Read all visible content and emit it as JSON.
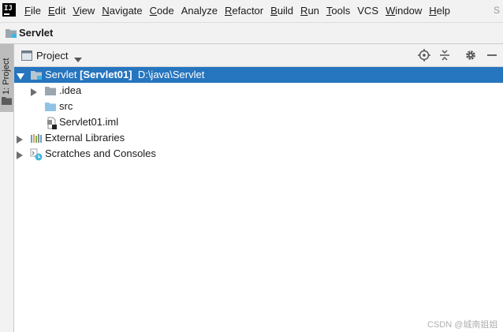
{
  "app": {
    "logo_text": "IJ"
  },
  "menu": [
    {
      "mnemonic": "F",
      "rest": "ile"
    },
    {
      "mnemonic": "E",
      "rest": "dit"
    },
    {
      "mnemonic": "V",
      "rest": "iew"
    },
    {
      "mnemonic": "N",
      "rest": "avigate"
    },
    {
      "mnemonic": "C",
      "rest": "ode"
    },
    {
      "mnemonic": "",
      "rest": "Analyze"
    },
    {
      "mnemonic": "R",
      "rest": "efactor"
    },
    {
      "mnemonic": "B",
      "rest": "uild"
    },
    {
      "mnemonic": "R",
      "rest": "un"
    },
    {
      "mnemonic": "T",
      "rest": "ools"
    },
    {
      "mnemonic": "",
      "rest": "VCS"
    },
    {
      "mnemonic": "W",
      "rest": "indow"
    },
    {
      "mnemonic": "H",
      "rest": "elp"
    }
  ],
  "menu_overflow": "S",
  "nav": {
    "title": "Servlet"
  },
  "strip": {
    "label": "1: Project"
  },
  "panel": {
    "title": "Project",
    "buttons": [
      "locate-icon",
      "collapse-all-icon",
      "settings-icon",
      "minimize-icon"
    ]
  },
  "tree": {
    "root": {
      "name": "Servlet",
      "module": "[Servlet01]",
      "path": "D:\\java\\Servlet"
    },
    "idea": ".idea",
    "src": "src",
    "iml": "Servlet01.iml",
    "libraries": "External Libraries",
    "scratches": "Scratches and Consoles"
  },
  "watermark": "CSDN @城南姐姐",
  "colors": {
    "selection": "#2675bf",
    "folder": "#9aa7b0",
    "source_folder": "#8fc3e6"
  }
}
